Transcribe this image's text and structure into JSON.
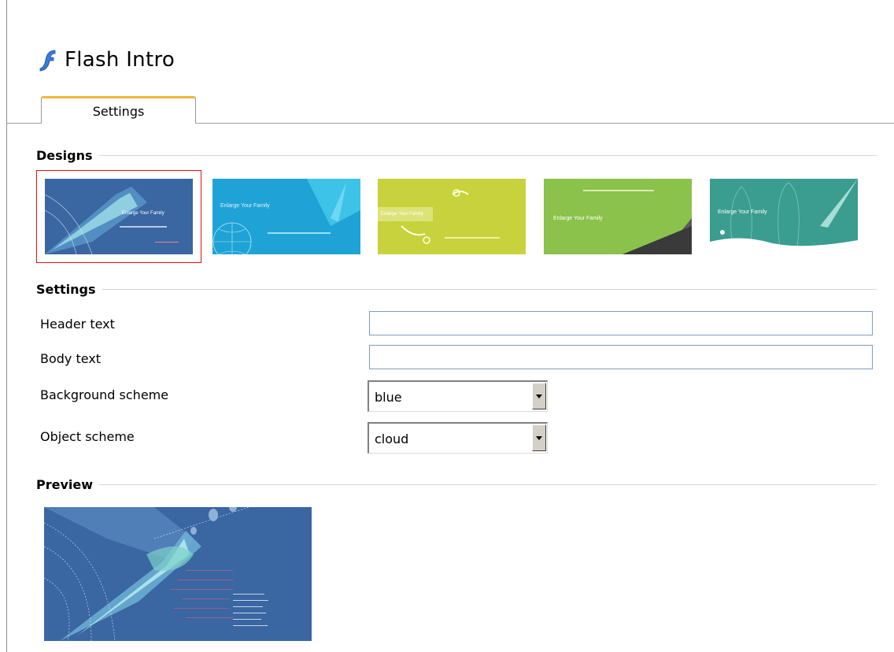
{
  "page": {
    "title": "Flash Intro",
    "title_icon": "flash-icon"
  },
  "tabs": [
    {
      "label": "Settings",
      "active": true
    }
  ],
  "designs": {
    "heading": "Designs",
    "selected_index": 0,
    "items": [
      {
        "name": "blue",
        "background": "#3a66a2",
        "caption": "Enlarge Your Family"
      },
      {
        "name": "cyan",
        "background": "#1fa3d6",
        "caption": "Enlarge Your Family"
      },
      {
        "name": "yellow",
        "background": "#c8d23c",
        "caption": "Enlarge Your Family"
      },
      {
        "name": "green",
        "background": "#8bc24b",
        "caption": "Enlarge Your Family"
      },
      {
        "name": "teal",
        "background": "#3a9d8f",
        "caption": "Enlarge Your Family"
      }
    ]
  },
  "settings": {
    "heading": "Settings",
    "header_text_label": "Header text",
    "header_text_value": "",
    "body_text_label": "Body text",
    "body_text_value": "",
    "background_scheme_label": "Background scheme",
    "background_scheme_value": "blue",
    "object_scheme_label": "Object scheme",
    "object_scheme_value": "cloud"
  },
  "preview": {
    "heading": "Preview",
    "background": "#3a66a2"
  },
  "colors": {
    "tab_accent": "#f2b43b",
    "selection": "#e01010"
  }
}
